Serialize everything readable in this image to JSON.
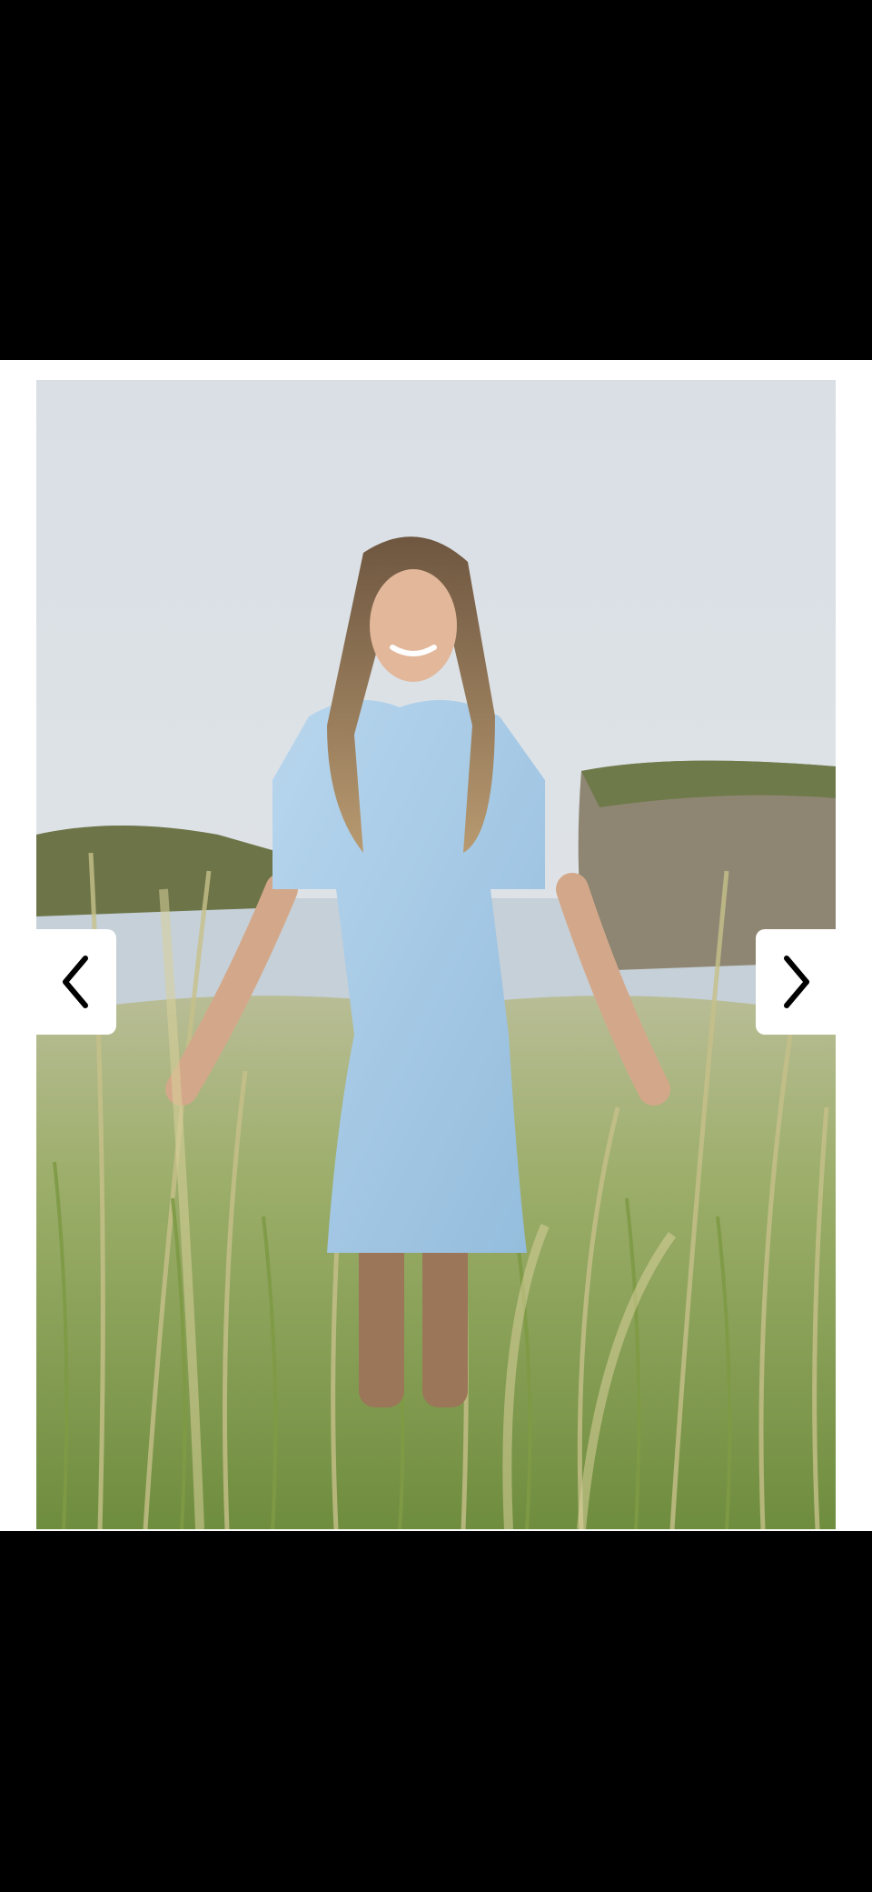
{
  "viewer": {
    "image_subject": "woman-in-light-blue-dress-walking-through-tall-grass",
    "prev_icon": "chevron-left-icon",
    "next_icon": "chevron-right-icon"
  },
  "colors": {
    "backdrop": "#000000",
    "frame": "#ffffff",
    "dress": "#a9cbe6",
    "grass": "#8aa05a",
    "sky": "#d7dde3"
  }
}
